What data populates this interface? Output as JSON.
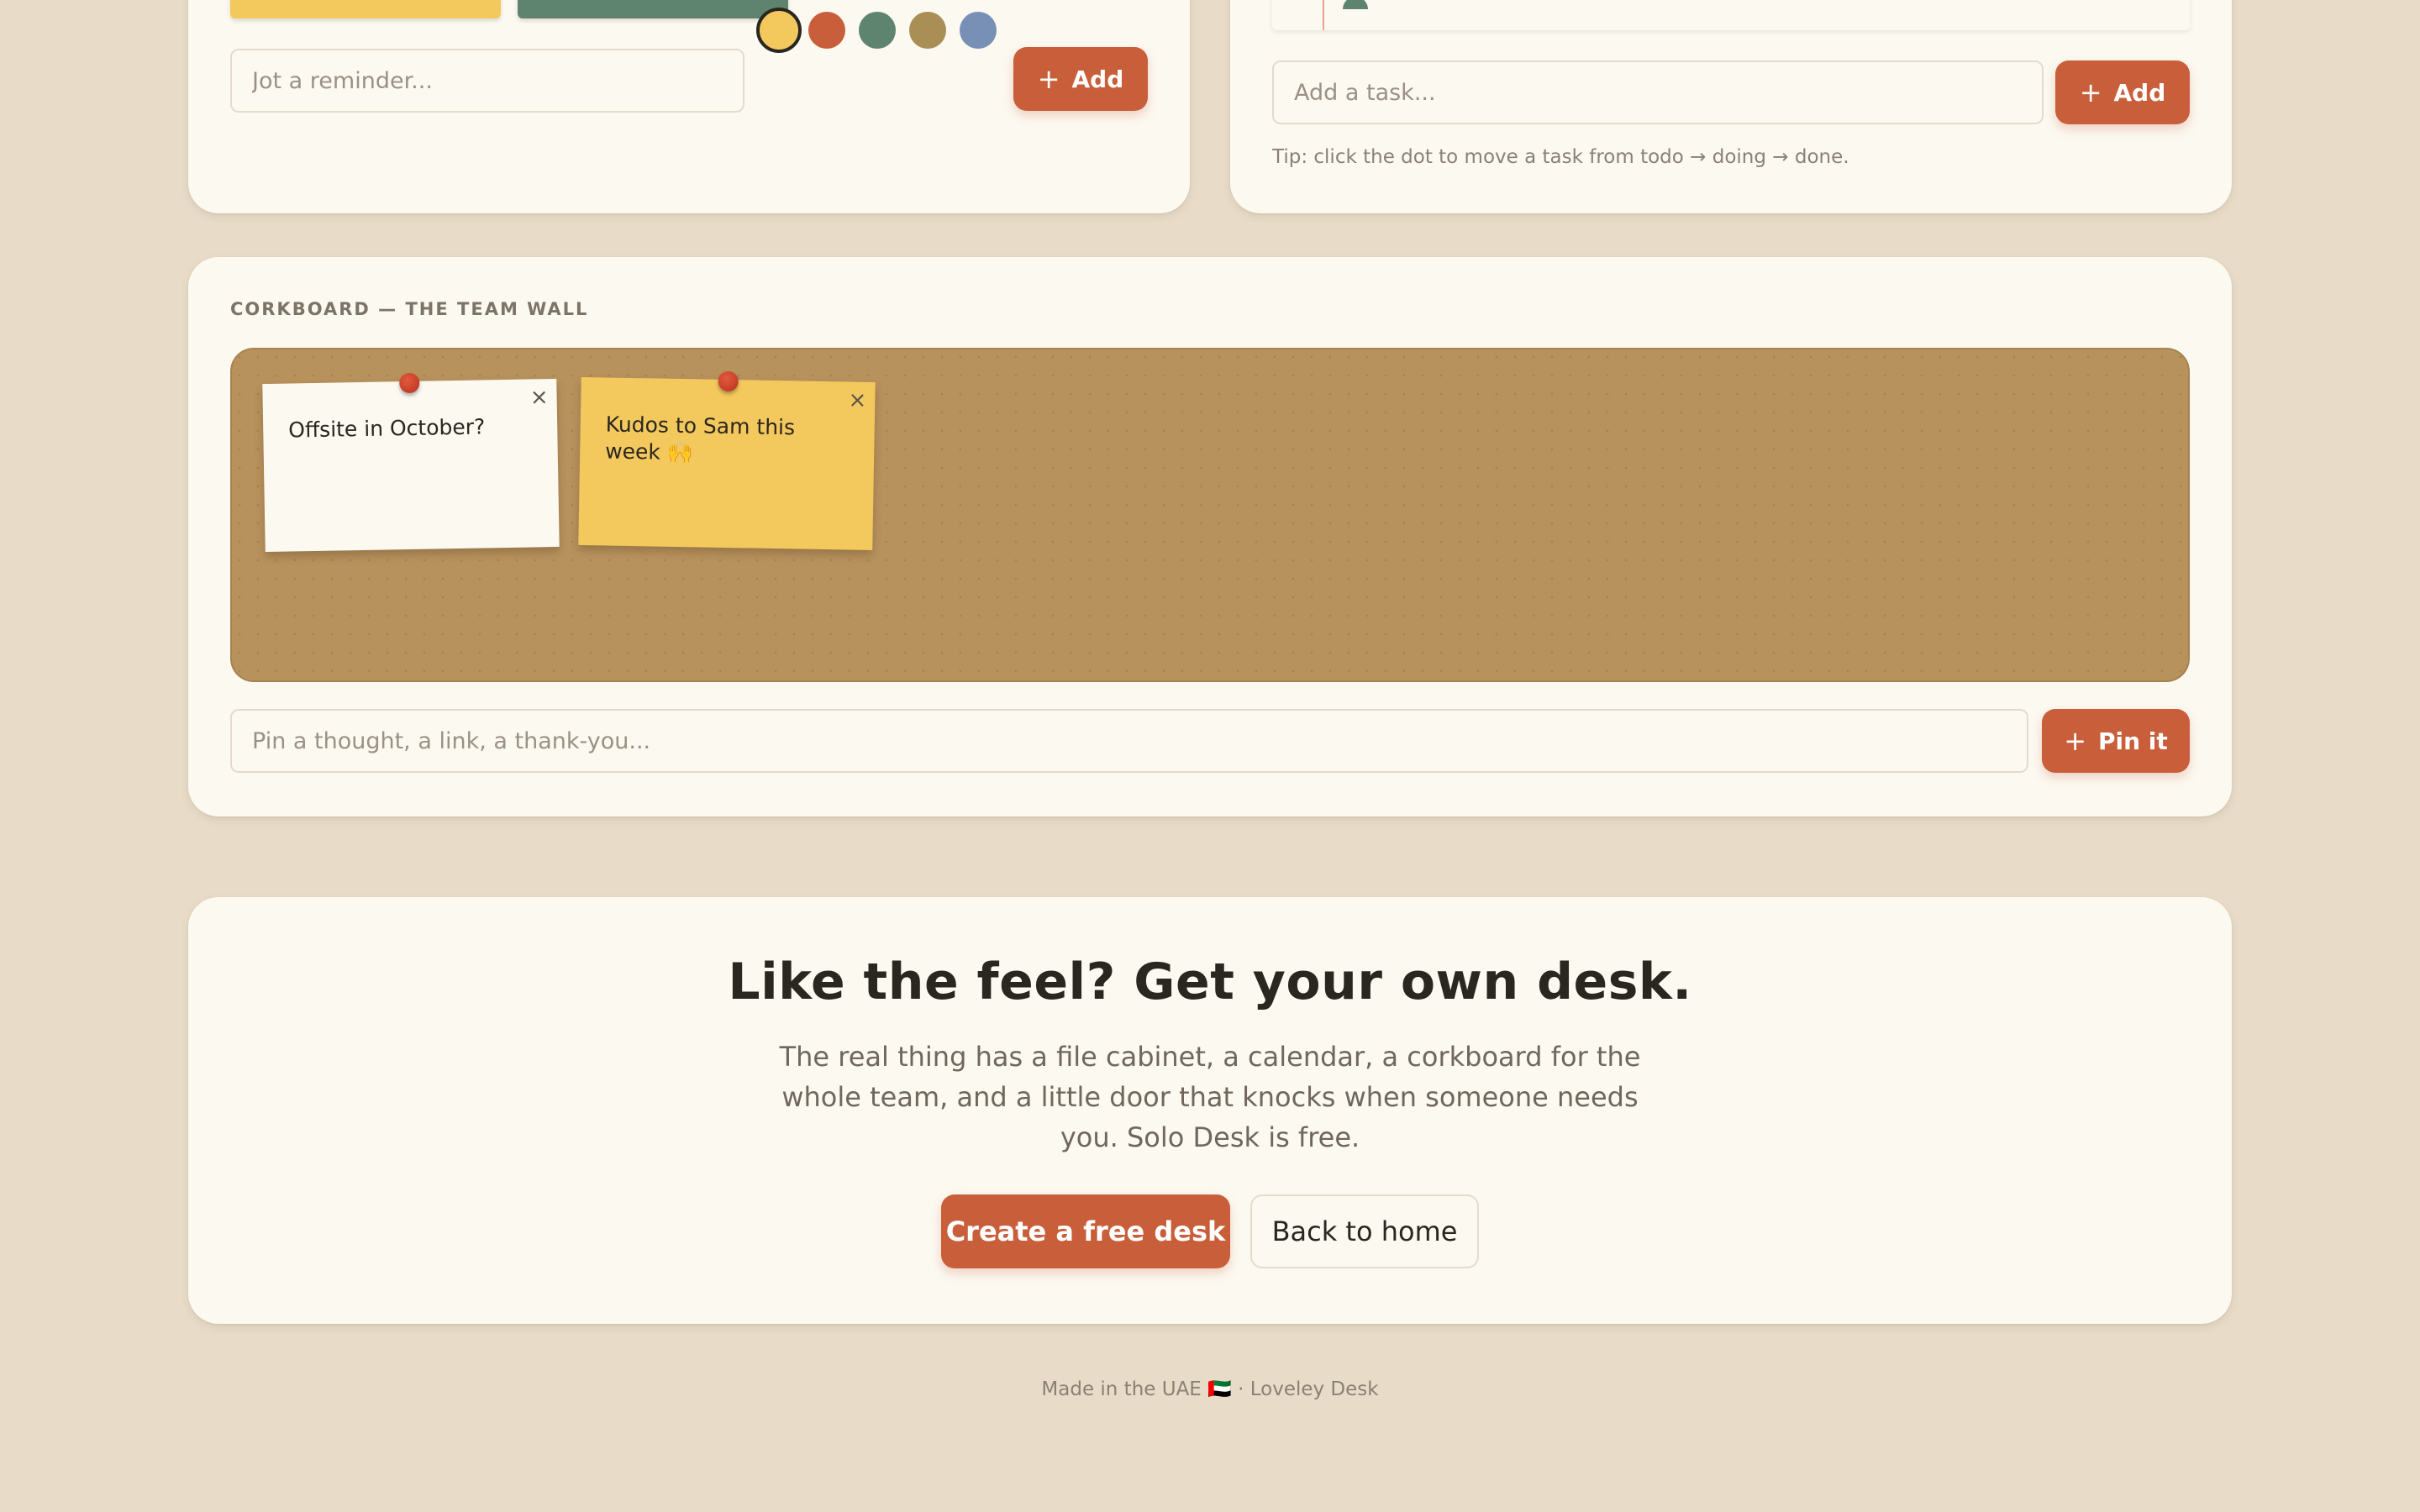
{
  "reminders": {
    "input_placeholder": "Jot a reminder...",
    "add_label": "Add",
    "colors": [
      "#f3c85d",
      "#c85f3a",
      "#5e8470",
      "#a98e55",
      "#7890b5"
    ],
    "selected_color": "#f3c85d",
    "strip_colors": [
      "#f3c85d",
      "#5e8470"
    ]
  },
  "tasks": {
    "input_placeholder": "Add a task...",
    "add_label": "Add",
    "tip": "Tip: click the dot to move a task from todo → doing → done."
  },
  "corkboard": {
    "label": "CORKBOARD — THE TEAM WALL",
    "notes": [
      {
        "text": "Offsite in October?",
        "color": "#fcf9f1"
      },
      {
        "text": "Kudos to Sam this week 🙌",
        "color": "#f3c85d"
      }
    ],
    "close_label": "×",
    "input_placeholder": "Pin a thought, a link, a thank-you...",
    "pin_label": "Pin it"
  },
  "cta": {
    "title": "Like the feel? Get your own desk.",
    "text": "The real thing has a file cabinet, a calendar, a corkboard for the whole team, and a little door that knocks when someone needs you. Solo Desk is free.",
    "primary_label": "Create a free desk",
    "secondary_label": "Back to home"
  },
  "footer": {
    "text": "Made in the UAE 🇦🇪 · Loveley Desk"
  },
  "colors": {
    "accent": "#c85f3a",
    "background": "#e8dcc8",
    "card": "#fcf9f1",
    "cork": "#b8925d"
  }
}
